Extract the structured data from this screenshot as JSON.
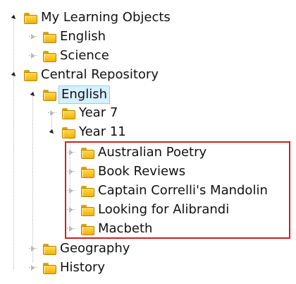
{
  "tree": {
    "items": [
      {
        "label": "My Learning Objects",
        "state": "expanded"
      },
      {
        "label": "English",
        "state": "collapsed"
      },
      {
        "label": "Science",
        "state": "collapsed"
      },
      {
        "label": "Central Repository",
        "state": "expanded"
      },
      {
        "label": "English",
        "state": "expanded",
        "selected": true
      },
      {
        "label": "Year 7",
        "state": "collapsed"
      },
      {
        "label": "Year 11",
        "state": "expanded"
      },
      {
        "label": "Australian Poetry",
        "state": "collapsed"
      },
      {
        "label": "Book Reviews",
        "state": "collapsed"
      },
      {
        "label": "Captain Correlli's Mandolin",
        "state": "collapsed"
      },
      {
        "label": "Looking for Alibrandi",
        "state": "collapsed"
      },
      {
        "label": "Macbeth",
        "state": "collapsed"
      },
      {
        "label": "Geography",
        "state": "collapsed"
      },
      {
        "label": "History",
        "state": "collapsed"
      }
    ]
  },
  "colors": {
    "selection_fill": "#d7f0ff",
    "selection_border": "#8fd0f5",
    "highlight_border": "#d11f1f",
    "folder_yellow": "#ffd94e"
  }
}
